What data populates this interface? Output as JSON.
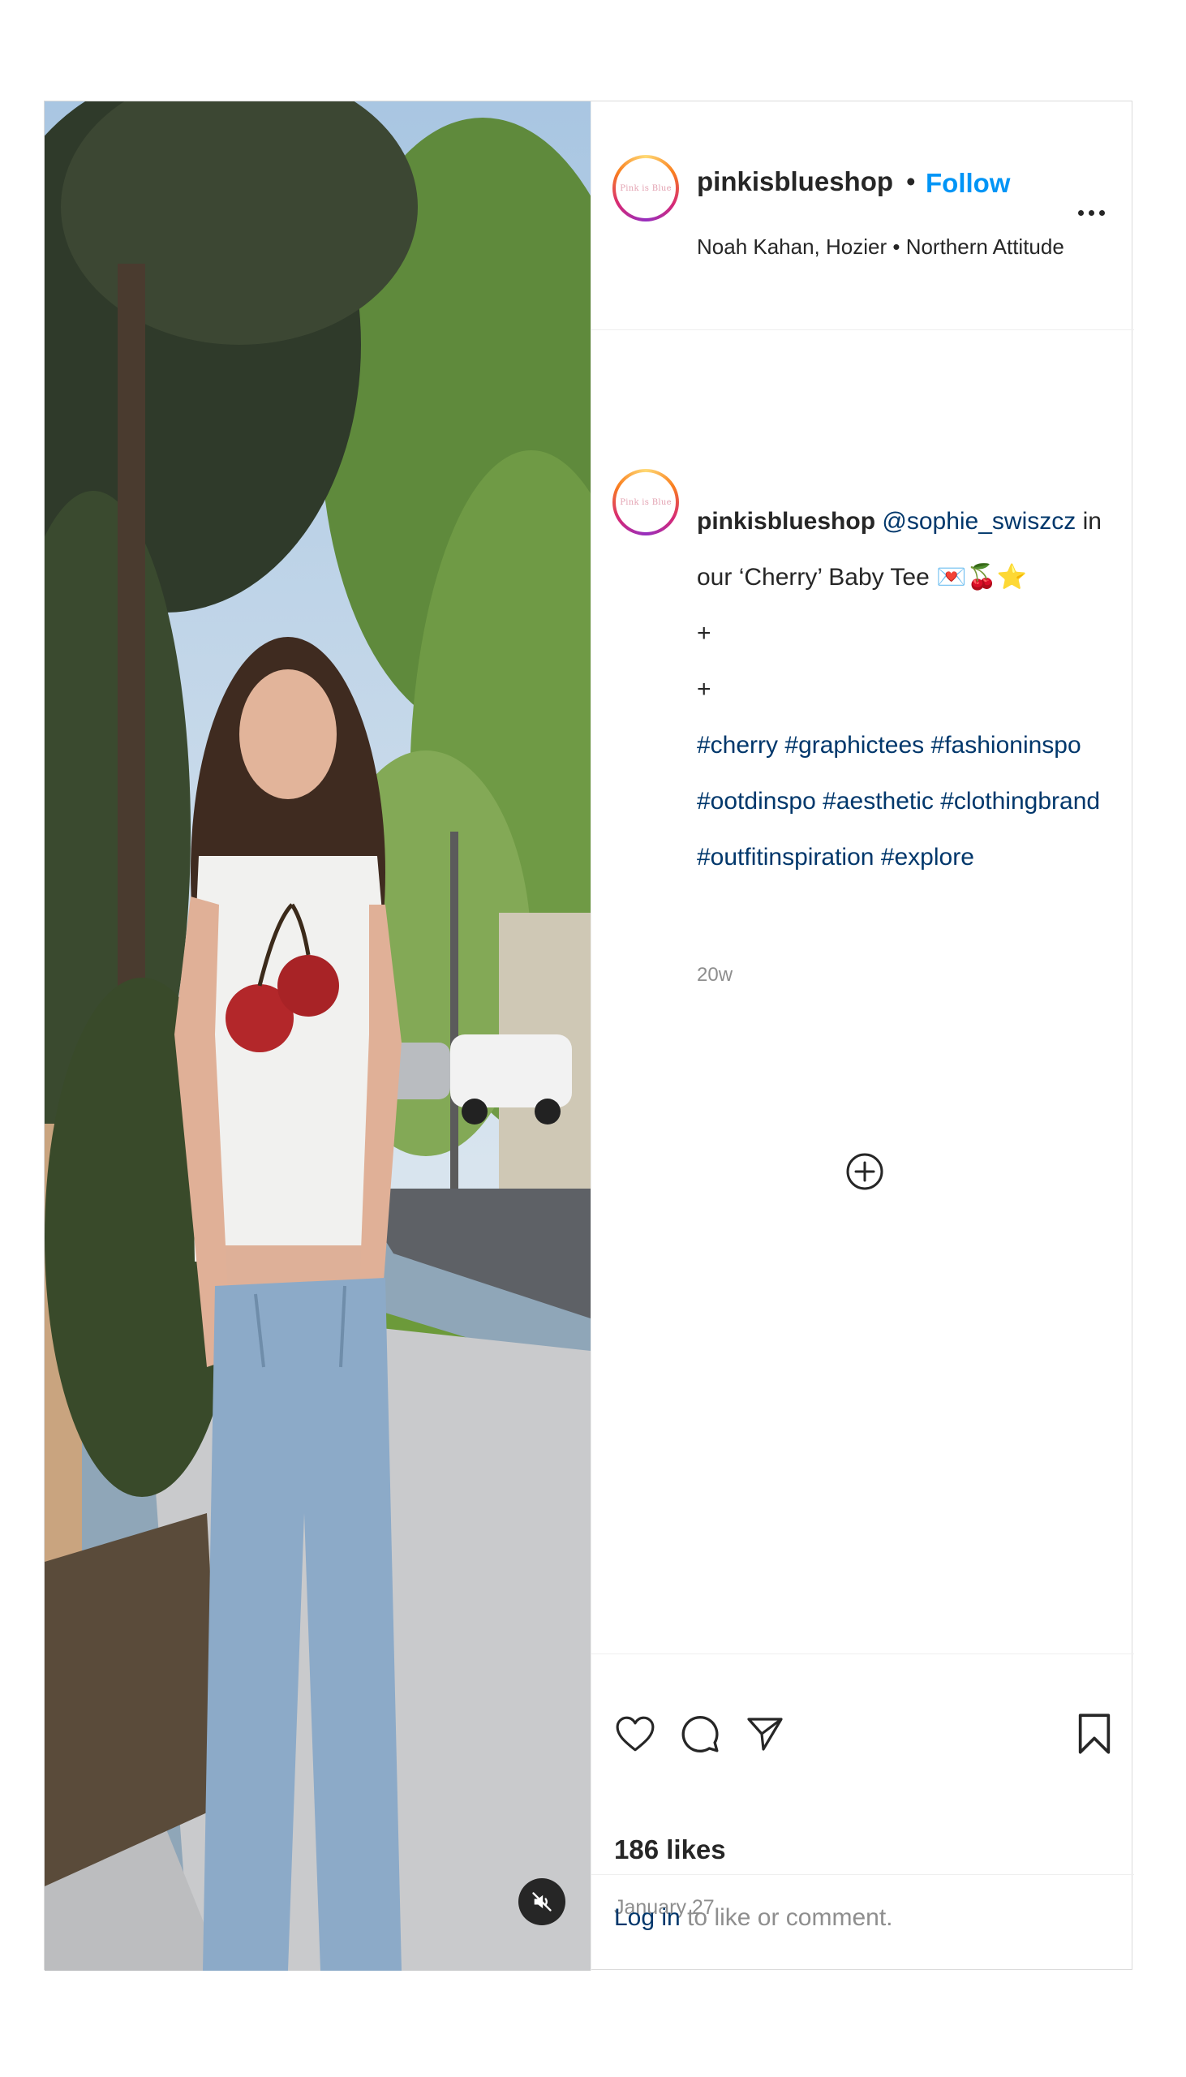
{
  "post": {
    "account": {
      "username": "pinkisblueshop",
      "separator": "•",
      "follow_label": "Follow",
      "audio": "Noah Kahan, Hozier • Northern Attitude",
      "avatar_text": "Pink is Blue"
    },
    "caption": {
      "username": "pinkisblueshop",
      "mention": "@sophie_swiszcz",
      "text_after_mention": " in",
      "line2": "our ‘Cherry’ Baby Tee 💌🍒⭐",
      "line3": "+",
      "line4": "+",
      "hashtags_line1": [
        "#cherry",
        "#graphictees",
        "#fashioninspo"
      ],
      "hashtags_line2": [
        "#ootdinspo",
        "#aesthetic",
        "#clothingbrand"
      ],
      "hashtags_line3": [
        "#outfitinspiration",
        "#explore"
      ]
    },
    "timestamp": "20w",
    "likes": "186 likes",
    "date": "January 27",
    "login_link": "Log in",
    "login_rest": " to like or comment."
  },
  "icons": {
    "more": "more-options-icon",
    "load_more": "plus-circle-icon",
    "like": "heart-icon",
    "comment": "comment-icon",
    "share": "send-icon",
    "save": "bookmark-icon",
    "mute": "speaker-muted-icon"
  },
  "colors": {
    "link_blue": "#0095f6",
    "hashtag_blue": "#00376b",
    "muted_gray": "#8e8e8e",
    "text": "#262626",
    "border": "#dbdbdb"
  }
}
